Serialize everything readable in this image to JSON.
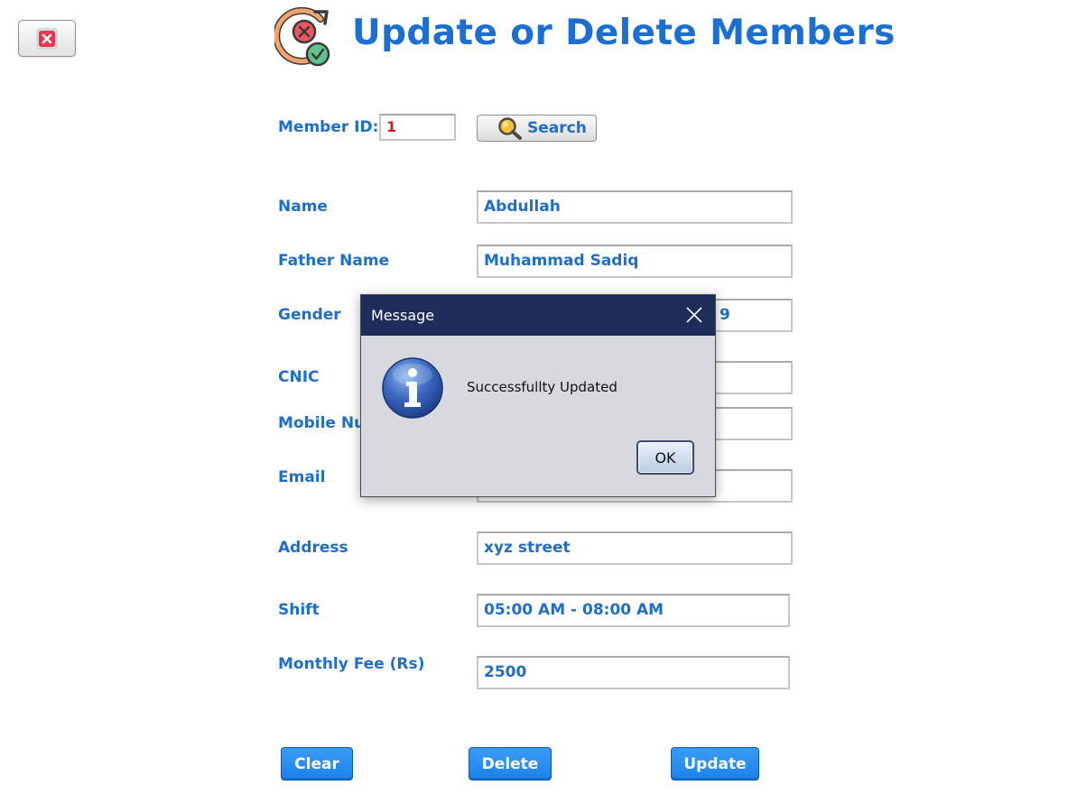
{
  "window": {
    "close_icon": "close-icon",
    "title": "Update or Delete Members",
    "title_icon": "sync-cancel-check-icon",
    "title_color": "#1a6fd1"
  },
  "search": {
    "member_id_label": "Member ID:",
    "member_id_value": "1",
    "button_label": "Search",
    "button_icon": "magnifier-icon"
  },
  "form": {
    "name_label": "Name",
    "name_value": "Abdullah",
    "father_name_label": "Father Name",
    "father_name_value": "Muhammad Sadiq",
    "gender_label": "Gender",
    "gender_value_visible": "9",
    "cnic_label": "CNIC",
    "mobile_label_visible": "Mobile Nu",
    "email_label": "Email",
    "address_label": "Address",
    "address_value": "xyz street",
    "shift_label": "Shift",
    "shift_value": "05:00 AM - 08:00 AM",
    "fee_label": "Monthly Fee (Rs)",
    "fee_value": "2500"
  },
  "actions": {
    "clear_label": "Clear",
    "delete_label": "Delete",
    "update_label": "Update",
    "button_color": "#1a82ec"
  },
  "dialog": {
    "title": "Message",
    "message": "Successfullty Updated",
    "ok_label": "OK",
    "icon": "info-icon",
    "titlebar_color": "#1f2d5a"
  }
}
